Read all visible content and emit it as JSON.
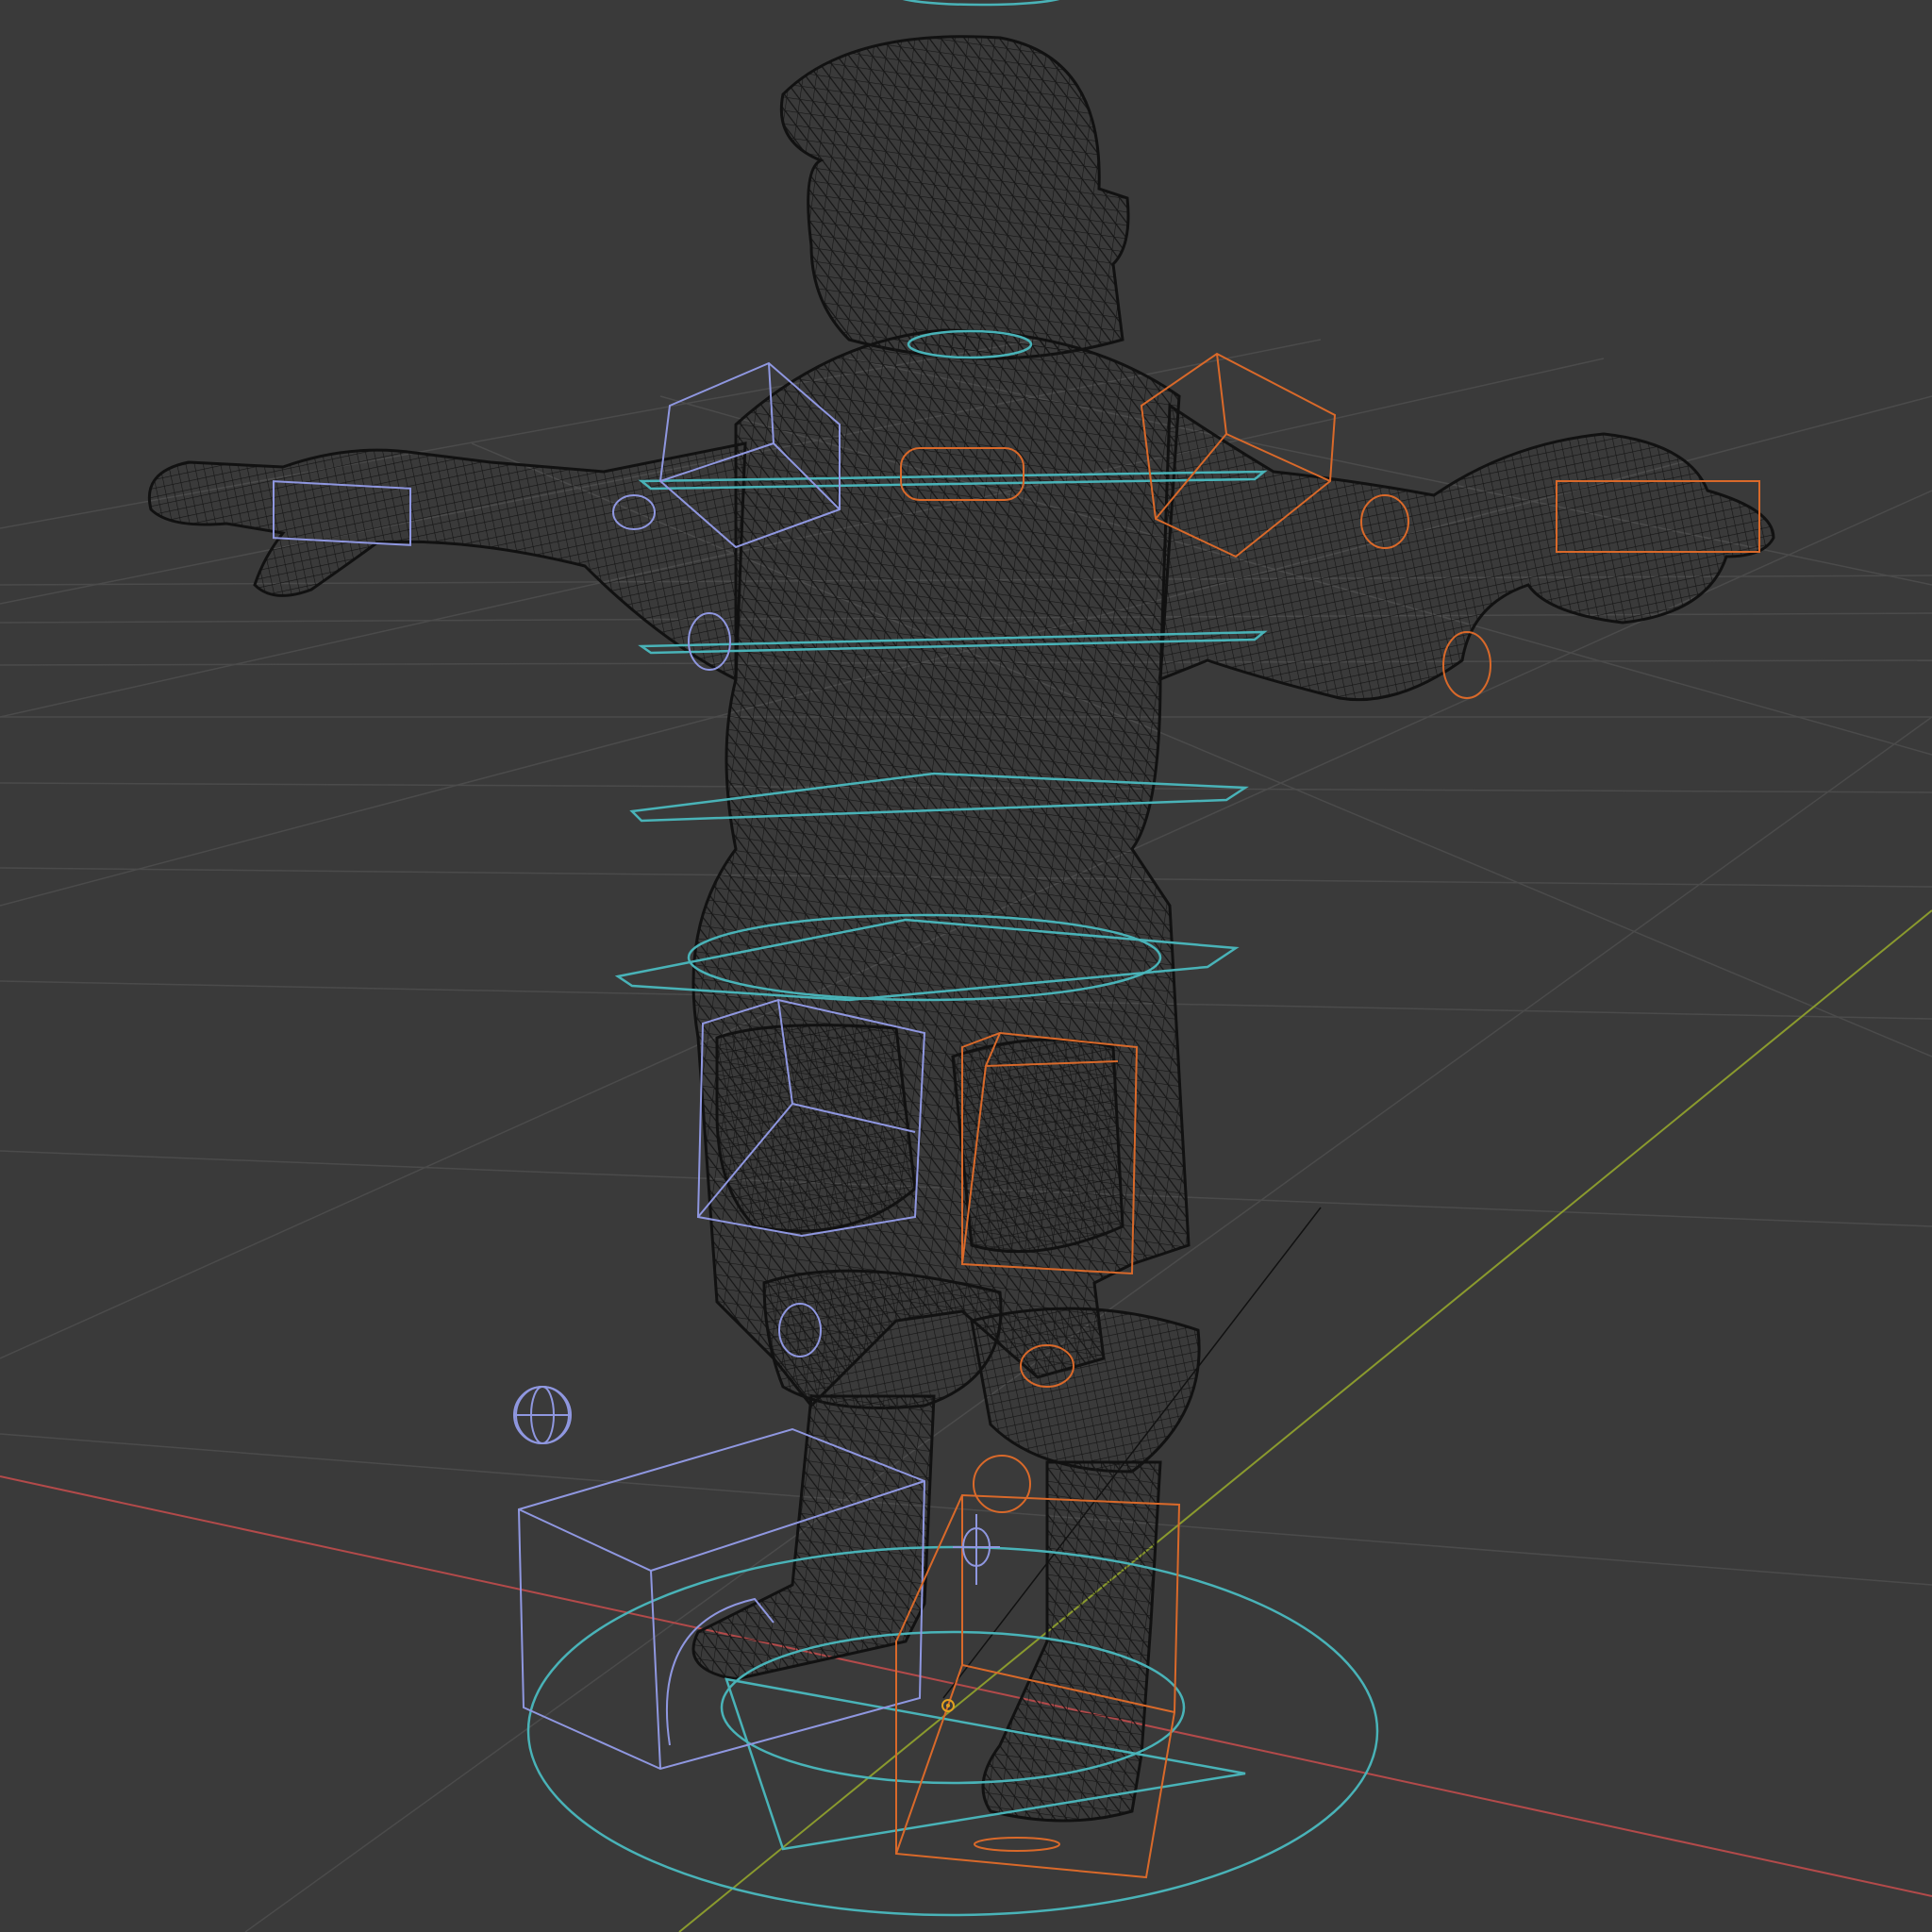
{
  "viewport": {
    "mode": "wireframe",
    "background": "#3a3a3a",
    "grid_color": "#4a4a4a",
    "axis_x_color": "#b34a4a",
    "axis_y_color": "#8a9a2e",
    "mesh_color": "#151515",
    "control_left_color": "#8f97e0",
    "control_right_color": "#d9692a",
    "control_center_color": "#49b3b8",
    "origin_color": "#e0a020"
  },
  "scene": {
    "object": "character-rig",
    "icons": {
      "origin": "origin-marker-icon",
      "empty": "sphere-empty-icon",
      "pivot": "pivot-gizmo-icon"
    }
  }
}
